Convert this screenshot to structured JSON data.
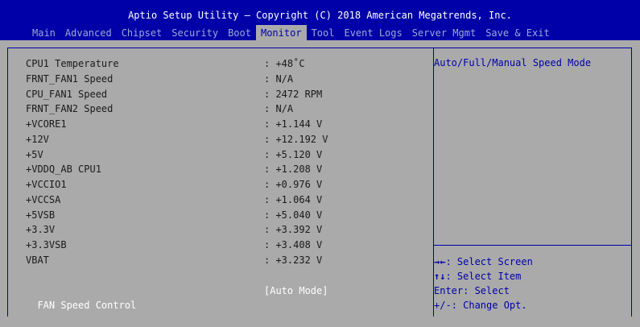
{
  "title": "Aptio Setup Utility – Copyright (C) 2018 American Megatrends, Inc.",
  "menu": [
    {
      "label": "Main"
    },
    {
      "label": "Advanced"
    },
    {
      "label": "Chipset"
    },
    {
      "label": "Security"
    },
    {
      "label": "Boot"
    },
    {
      "label": "Monitor"
    },
    {
      "label": "Tool"
    },
    {
      "label": "Event Logs"
    },
    {
      "label": "Server Mgmt"
    },
    {
      "label": "Save & Exit"
    }
  ],
  "readings": [
    {
      "label": "CPU1 Temperature",
      "value": ": +48˚C"
    },
    {
      "label": "FRNT_FAN1 Speed",
      "value": ": N/A"
    },
    {
      "label": "CPU_FAN1 Speed",
      "value": ": 2472 RPM"
    },
    {
      "label": "FRNT_FAN2 Speed",
      "value": ": N/A"
    },
    {
      "label": "+VCORE1",
      "value": ": +1.144 V"
    },
    {
      "label": "+12V",
      "value": ": +12.192 V"
    },
    {
      "label": "+5V",
      "value": ": +5.120 V"
    },
    {
      "label": "+VDDQ_AB CPU1",
      "value": ": +1.208 V"
    },
    {
      "label": "+VCCIO1",
      "value": ": +0.976 V"
    },
    {
      "label": "+VCCSA",
      "value": ": +1.064 V"
    },
    {
      "label": "+5VSB",
      "value": ": +5.040 V"
    },
    {
      "label": "+3.3V",
      "value": ": +3.392 V"
    },
    {
      "label": "+3.3VSB",
      "value": ": +3.408 V"
    },
    {
      "label": "VBAT",
      "value": ": +3.232 V"
    }
  ],
  "fan_control": {
    "label": "FAN Speed Control",
    "value": "[Auto Mode]"
  },
  "help_text": "Auto/Full/Manual Speed Mode",
  "keys": [
    {
      "key": "→←",
      "desc": ": Select Screen"
    },
    {
      "key": "↑↓",
      "desc": ": Select Item"
    },
    {
      "key": "Enter",
      "desc": ": Select"
    },
    {
      "key": "+/-",
      "desc": ": Change Opt."
    }
  ],
  "colors": {
    "header_bg": "#0000a8",
    "panel_bg": "#aaaaaa",
    "highlight_text": "#ffffff"
  }
}
